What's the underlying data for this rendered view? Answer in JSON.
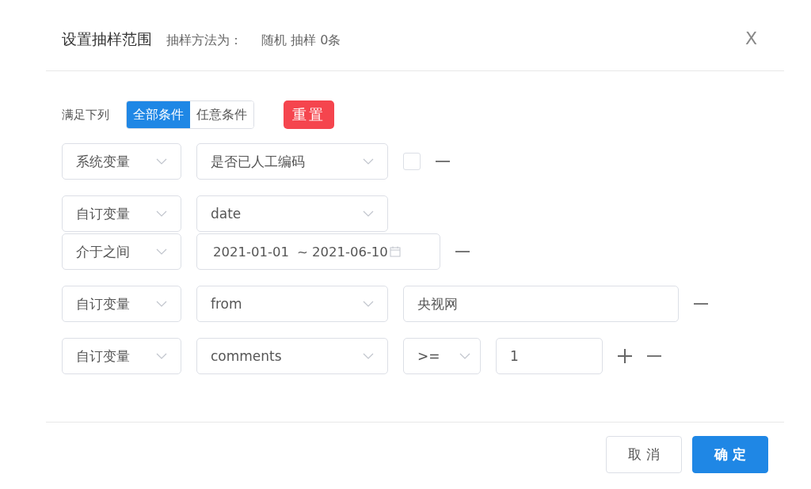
{
  "dialog": {
    "title": "设置抽样范围",
    "method_label": "抽样方法为：",
    "method_value": "随机 抽样 0条",
    "close": "X"
  },
  "match": {
    "label": "满足下列",
    "options": [
      {
        "label": "全部条件",
        "selected": true
      },
      {
        "label": "任意条件",
        "selected": false
      }
    ],
    "reset": "重置"
  },
  "conditions": [
    {
      "lines": [
        [
          {
            "kind": "category",
            "value": "系统变量"
          },
          {
            "kind": "field",
            "value": "是否已人工编码"
          },
          {
            "kind": "checkbox",
            "checked": false
          },
          {
            "kind": "remove"
          }
        ]
      ]
    },
    {
      "lines": [
        [
          {
            "kind": "category",
            "value": "自订变量"
          },
          {
            "kind": "field",
            "value": "date"
          }
        ],
        [
          {
            "kind": "category",
            "value": "介于之间"
          },
          {
            "kind": "daterange",
            "start": "2021-01-01",
            "end": "~ 2021-06-10"
          },
          {
            "kind": "remove"
          }
        ]
      ]
    },
    {
      "lines": [
        [
          {
            "kind": "category",
            "value": "自订变量"
          },
          {
            "kind": "field",
            "value": "from"
          },
          {
            "kind": "text",
            "value": "央视网"
          },
          {
            "kind": "remove"
          }
        ]
      ]
    },
    {
      "lines": [
        [
          {
            "kind": "category",
            "value": "自订变量"
          },
          {
            "kind": "field",
            "value": "comments"
          },
          {
            "kind": "operator",
            "value": ">="
          },
          {
            "kind": "number",
            "value": "1"
          },
          {
            "kind": "add"
          },
          {
            "kind": "remove"
          }
        ]
      ]
    }
  ],
  "buttons": [
    {
      "label": "取 消",
      "primary": false
    },
    {
      "label": "确 定",
      "primary": true
    }
  ]
}
